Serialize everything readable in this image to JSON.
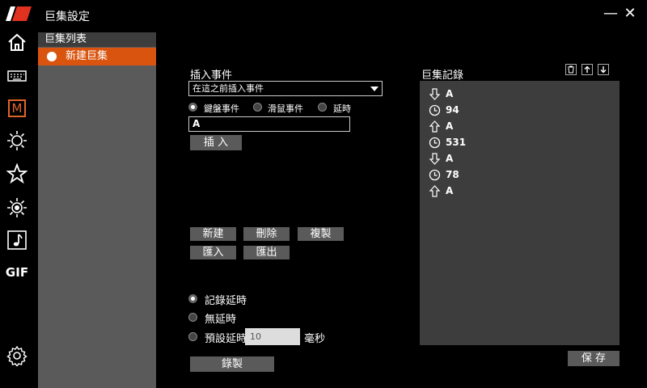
{
  "window": {
    "title": "巨集設定",
    "minimize_glyph": "—",
    "close_glyph": "✕"
  },
  "nav": [
    "home-icon",
    "keyboard-icon",
    "macro-icon",
    "brightness-icon",
    "star-icon",
    "light-effect-icon",
    "music-icon",
    "gif-icon",
    "settings-icon"
  ],
  "nav_labels": {
    "macro": "M",
    "gif": "GIF"
  },
  "macro_list": {
    "header": "巨集列表",
    "items": [
      {
        "label": "新建巨集",
        "selected": true
      }
    ]
  },
  "insert": {
    "title": "插入事件",
    "position_selected": "在這之前插入事件",
    "event_types": [
      {
        "label": "鍵盤事件",
        "checked": true
      },
      {
        "label": "滑鼠事件",
        "checked": false
      },
      {
        "label": "延時",
        "checked": false
      }
    ],
    "key_value": "A",
    "insert_button": "插 入"
  },
  "actions": {
    "new": "新建",
    "delete": "刪除",
    "copy": "複製",
    "import": "匯入",
    "export": "匯出"
  },
  "delay_options": [
    {
      "label": "記錄延時",
      "checked": true
    },
    {
      "label": "無延時",
      "checked": false
    },
    {
      "label": "預設延時",
      "checked": false
    }
  ],
  "default_delay": {
    "value": "10",
    "unit": "毫秒"
  },
  "record_button": "錄製",
  "record": {
    "title": "巨集記錄",
    "events": [
      {
        "icon": "arrow-down-icon",
        "text": "A"
      },
      {
        "icon": "clock-icon",
        "text": "94"
      },
      {
        "icon": "arrow-up-icon",
        "text": "A"
      },
      {
        "icon": "clock-icon",
        "text": "531"
      },
      {
        "icon": "arrow-down-icon",
        "text": "A"
      },
      {
        "icon": "clock-icon",
        "text": "78"
      },
      {
        "icon": "arrow-up-icon",
        "text": "A"
      }
    ],
    "save_button": "保 存"
  },
  "colors": {
    "accent": "#d9540f",
    "panel": "#5a5a5a",
    "record_panel": "#3d3d3d",
    "background": "#000000"
  }
}
